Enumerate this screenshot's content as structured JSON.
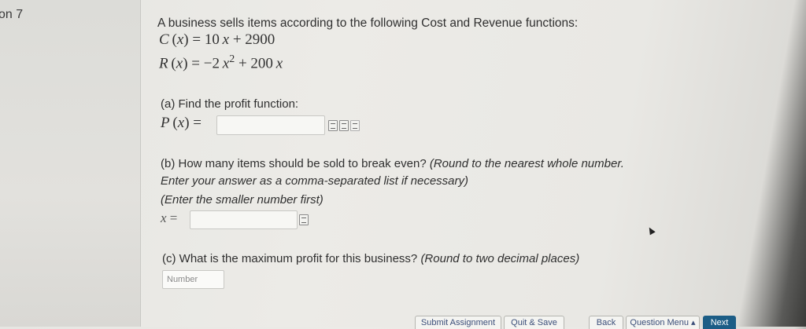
{
  "sidebar": {
    "question_label": "on 7"
  },
  "problem": {
    "intro": "A business sells items according to the following Cost and Revenue functions:",
    "cost_fn": {
      "lhs": "C",
      "var": "x",
      "coef": "10",
      "const": "+ 2900"
    },
    "revenue_fn": {
      "lhs": "R",
      "var": "x",
      "a": "−2",
      "exp": "2",
      "b": "+ 200"
    }
  },
  "part_a": {
    "prompt": "(a) Find the profit function:",
    "lhs": "P",
    "var": "x",
    "answer": ""
  },
  "part_b": {
    "prompt": "(b) How many items should be sold to break even?",
    "hint1": "(Round to the nearest whole number.",
    "hint2": "Enter your answer as a comma-separated list if necessary)",
    "hint3": "(Enter the smaller number first)",
    "var": "x",
    "answer": ""
  },
  "part_c": {
    "prompt": "(c) What is the maximum profit for this business?",
    "hint": "(Round to two decimal places)",
    "placeholder": "Number"
  },
  "footer": {
    "submit": "Submit Assignment",
    "quit": "Quit & Save",
    "back": "Back",
    "question_menu": "Question Menu ▴",
    "next": "Next"
  }
}
